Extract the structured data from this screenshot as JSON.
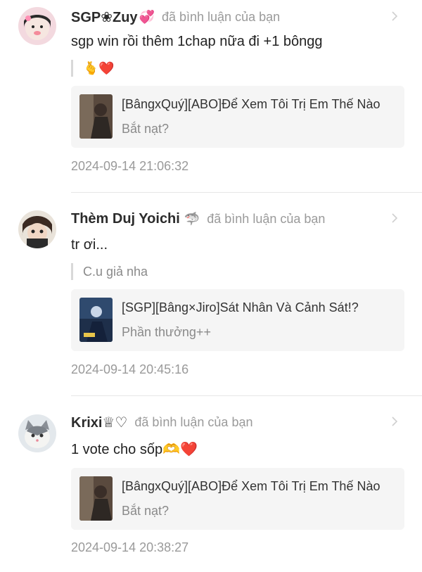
{
  "comments": [
    {
      "username": "SGP❀Zuy",
      "name_emoji": "💞",
      "action": "đã bình luận của bạn",
      "text": "sgp win rồi thêm 1chap nữa đi +1 bôngg",
      "quote": "🫰❤️",
      "card": {
        "title": "[BângxQuý][ABO]Để Xem Tôi Trị Em Thế Nào",
        "subtitle": "Bắt nạt?"
      },
      "timestamp": "2024-09-14 21:06:32"
    },
    {
      "username": "Thèm Duj Yoichi",
      "name_emoji": "🦈",
      "action": "đã bình luận của bạn",
      "text": "tr ơi...",
      "quote": "C.u giả nha",
      "card": {
        "title": "[SGP][Bâng×Jiro]Sát Nhân Và Cảnh Sát!?",
        "subtitle": "Phần thưởng++"
      },
      "timestamp": "2024-09-14 20:45:16"
    },
    {
      "username": "Krixi♕♡",
      "name_emoji": "",
      "action": "đã bình luận của bạn",
      "text": "1 vote cho sốp🫶❤️",
      "quote": "",
      "card": {
        "title": "[BângxQuý][ABO]Để Xem Tôi Trị Em Thế Nào",
        "subtitle": "Bắt nạt?"
      },
      "timestamp": "2024-09-14 20:38:27"
    }
  ]
}
